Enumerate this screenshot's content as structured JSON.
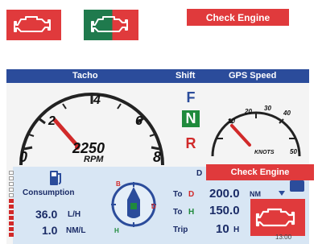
{
  "legend": {
    "icon_red": "engine-icon",
    "icon_split": "engine-icon",
    "badge_label": "Check Engine",
    "colors": {
      "alert_red": "#e03a3c",
      "ok_green": "#1f7a4d"
    }
  },
  "display": {
    "header": {
      "tacho": "Tacho",
      "shift": "Shift",
      "gps_speed": "GPS Speed"
    },
    "tacho": {
      "ticks": [
        "0",
        "2",
        "4",
        "6",
        "8"
      ],
      "rpm_value": "2250",
      "rpm_unit": "RPM"
    },
    "shift": {
      "f": "F",
      "n": "N",
      "r": "R",
      "selected": "N"
    },
    "gps": {
      "ticks": [
        "10",
        "20",
        "30",
        "40",
        "50"
      ],
      "unit": "KNOTS"
    },
    "consumption": {
      "title": "Consumption",
      "rate_value": "36.0",
      "rate_unit": "L/H",
      "econ_value": "1.0",
      "econ_unit": "NM/L"
    },
    "compass": {
      "b": "B",
      "d": "D",
      "h": "H"
    },
    "nav": {
      "header_fragment": "D",
      "row1": {
        "label": "To",
        "target": "D",
        "value": "200.0",
        "unit": "NM"
      },
      "row2": {
        "label": "To",
        "target": "H",
        "value": "150.0"
      },
      "row3": {
        "label": "Trip",
        "value": "10",
        "unit": "H"
      }
    },
    "badge_label": "Check Engine",
    "time": "13:00",
    "colors": {
      "header": "#2b4c9b",
      "panel": "#d8e6f4",
      "alert": "#e03a3c"
    }
  }
}
